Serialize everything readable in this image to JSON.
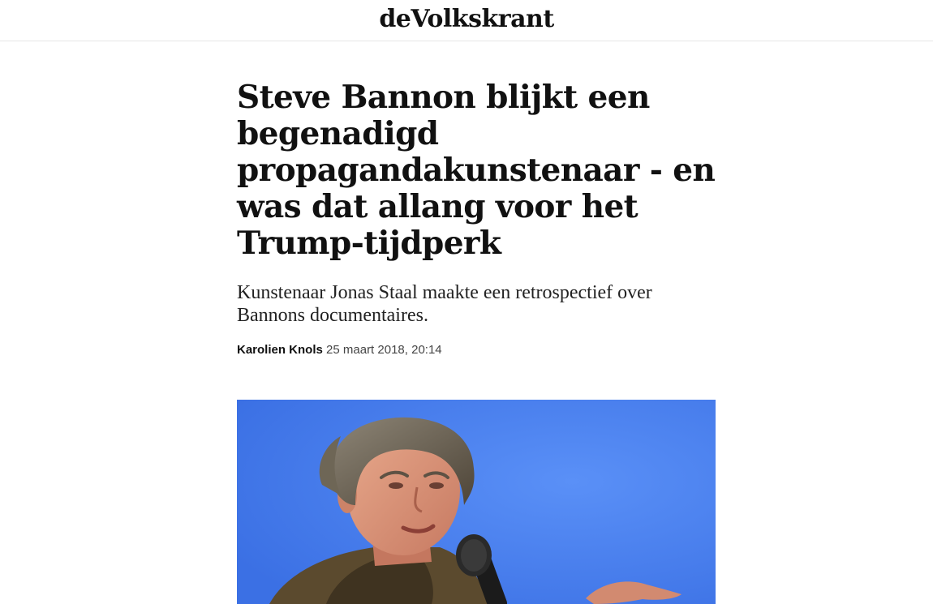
{
  "header": {
    "logo_text": "deVolkskrant"
  },
  "article": {
    "headline": "Steve Bannon blijkt een begenadigd propagandakunstenaar - en was dat allang voor het Trump-tijdperk",
    "intro": "Kunstenaar Jonas Staal maakte een retrospectief over Bannons documentaires.",
    "author": "Karolien Knols",
    "date": "25 maart 2018, 20:14"
  },
  "photo": {
    "subject": "man speaking into microphone against blue background"
  },
  "colors": {
    "photo_background": "#4a82f2",
    "text": "#111111",
    "divider": "#e6e6e6"
  }
}
